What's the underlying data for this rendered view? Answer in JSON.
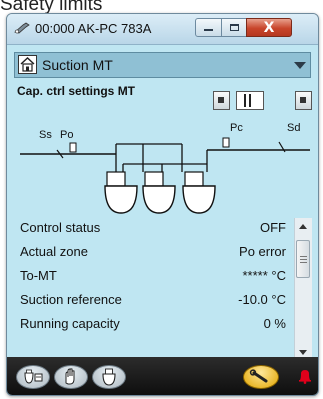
{
  "top_caption": "Safety limits",
  "window": {
    "title": "00:000 AK-PC 783A",
    "app_icon": "tool-icon",
    "minimize_icon": "minimize-icon",
    "maximize_icon": "maximize-icon",
    "close_icon": "close-icon",
    "close_glyph": "X"
  },
  "selector": {
    "home_icon": "home-icon",
    "label": "Suction MT",
    "arrow_icon": "dropdown-arrow-icon"
  },
  "panel": {
    "title": "Cap. ctrl settings MT",
    "prev_icon": "page-prev-icon",
    "next_icon": "page-next-icon",
    "page_indicator_icon": "page-indicator-icon"
  },
  "diagram": {
    "labels": {
      "ss": "Ss",
      "po": "Po",
      "pc": "Pc",
      "sd": "Sd"
    },
    "compressor_count": 3,
    "compressor_icon": "compressor-icon"
  },
  "status": {
    "rows": [
      {
        "label": "Control status",
        "value": "OFF"
      },
      {
        "label": "Actual zone",
        "value": "Po error"
      },
      {
        "label": "To-MT",
        "value": "***** °C"
      },
      {
        "label": "Suction reference",
        "value": "-10.0 °C"
      },
      {
        "label": "Running capacity",
        "value": "0 %"
      }
    ],
    "scrollbar": "vertical-scrollbar"
  },
  "bottom_bar": {
    "buttons": [
      "overview-icon",
      "hand-manual-icon",
      "compressor-icon"
    ],
    "service_icon": "wrench-icon",
    "alarm_icon": "alarm-bell-icon",
    "alarm_color": "#e0001b",
    "service_color": "#f0b400"
  },
  "colors": {
    "panel_bg": "#bfe6f2",
    "selector_bg": "#8fc0d4"
  }
}
